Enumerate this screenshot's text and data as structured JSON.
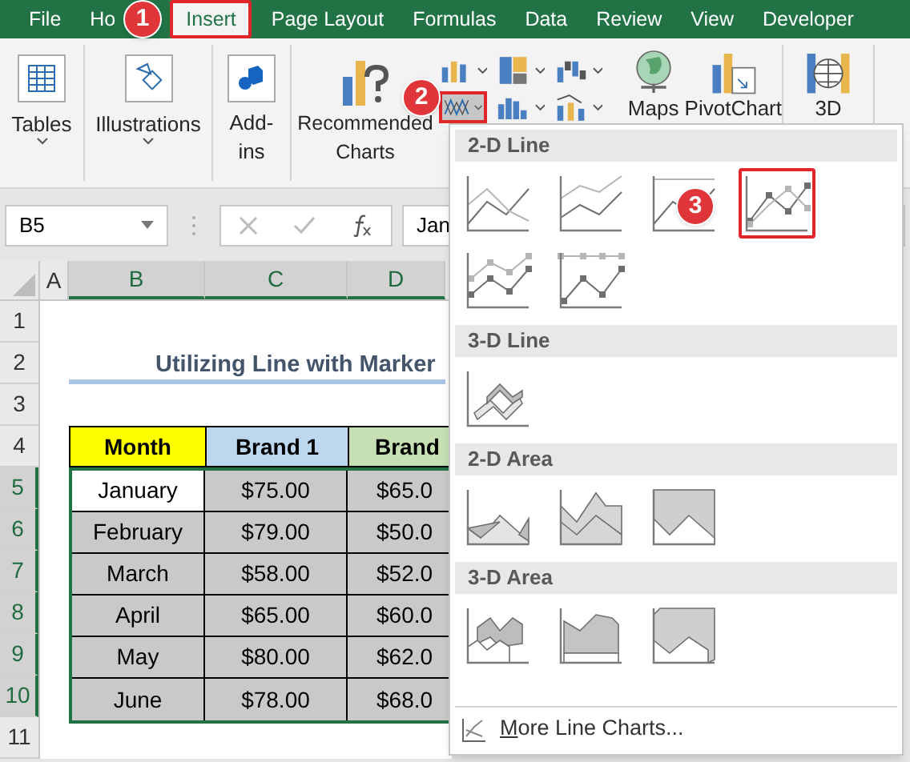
{
  "tabs": [
    {
      "label": "File",
      "selected": false
    },
    {
      "label": "Ho",
      "selected": false
    },
    {
      "label": "Insert",
      "selected": true
    },
    {
      "label": "Page Layout",
      "selected": false
    },
    {
      "label": "Formulas",
      "selected": false
    },
    {
      "label": "Data",
      "selected": false
    },
    {
      "label": "Review",
      "selected": false
    },
    {
      "label": "View",
      "selected": false
    },
    {
      "label": "Developer",
      "selected": false
    }
  ],
  "ribbon": {
    "tables": "Tables",
    "illustrations": "Illustrations",
    "add_ins": "Add-ins",
    "recommended_charts": "Recommended Charts",
    "line_chart_button": {
      "selected": true
    },
    "maps": "Maps",
    "pivotchart": "PivotChart",
    "three_d": "3D"
  },
  "formula_bar": {
    "name_box": "B5",
    "value": "Jan"
  },
  "sheet": {
    "columns": [
      {
        "label": "A",
        "selected": false
      },
      {
        "label": "B",
        "selected": true
      },
      {
        "label": "C",
        "selected": true
      },
      {
        "label": "D",
        "selected": true
      }
    ],
    "rows": [
      {
        "label": "1",
        "selected": false
      },
      {
        "label": "2",
        "selected": false
      },
      {
        "label": "3",
        "selected": false
      },
      {
        "label": "4",
        "selected": false
      },
      {
        "label": "5",
        "selected": true
      },
      {
        "label": "6",
        "selected": true
      },
      {
        "label": "7",
        "selected": true
      },
      {
        "label": "8",
        "selected": true
      },
      {
        "label": "9",
        "selected": true
      },
      {
        "label": "10",
        "selected": true
      },
      {
        "label": "11",
        "selected": false
      }
    ],
    "title": "Utilizing Line with Marker",
    "table": {
      "columns": [
        "Month",
        "Brand 1",
        "Brand"
      ],
      "rows": [
        {
          "cells": [
            "January",
            "$75.00",
            "$65.0"
          ],
          "active": true
        },
        {
          "cells": [
            "February",
            "$79.00",
            "$50.0"
          ],
          "active": false
        },
        {
          "cells": [
            "March",
            "$58.00",
            "$52.0"
          ],
          "active": false
        },
        {
          "cells": [
            "April",
            "$65.00",
            "$60.0"
          ],
          "active": false
        },
        {
          "cells": [
            "May",
            "$80.00",
            "$62.0"
          ],
          "active": false
        },
        {
          "cells": [
            "June",
            "$78.00",
            "$68.0"
          ],
          "active": false
        }
      ]
    }
  },
  "dropdown": {
    "sections": [
      {
        "title": "2-D Line",
        "items": [
          {
            "kind": "line",
            "selected": false
          },
          {
            "kind": "stacked-line",
            "selected": false
          },
          {
            "kind": "percent-line",
            "selected": false
          },
          {
            "kind": "line-markers",
            "selected": true
          },
          {
            "kind": "stacked-markers",
            "selected": false
          },
          {
            "kind": "percent-markers",
            "selected": false
          }
        ]
      },
      {
        "title": "3-D Line",
        "items": [
          {
            "kind": "line-3d",
            "selected": false
          }
        ]
      },
      {
        "title": "2-D Area",
        "items": [
          {
            "kind": "area",
            "selected": false
          },
          {
            "kind": "stacked-area",
            "selected": false
          },
          {
            "kind": "percent-area",
            "selected": false
          }
        ]
      },
      {
        "title": "3-D Area",
        "items": [
          {
            "kind": "area-3d",
            "selected": false
          },
          {
            "kind": "stacked-area-3d",
            "selected": false
          },
          {
            "kind": "percent-area-3d",
            "selected": false
          }
        ]
      }
    ],
    "more_link": "More Line Charts..."
  },
  "callouts": [
    "1",
    "2",
    "3"
  ]
}
